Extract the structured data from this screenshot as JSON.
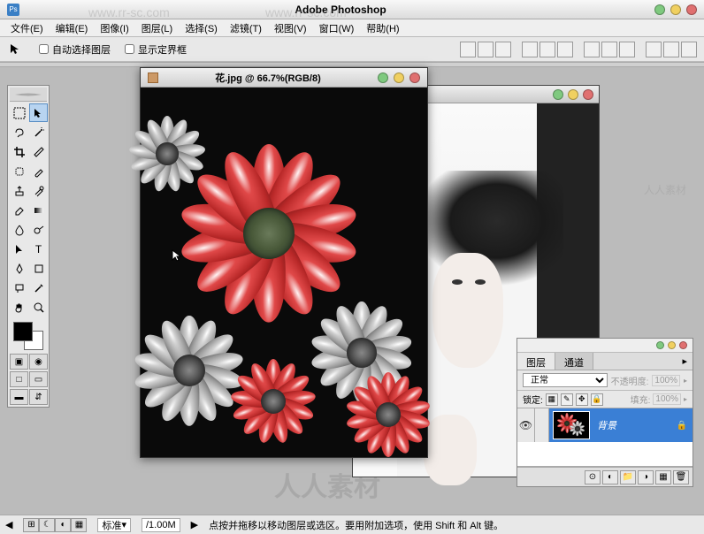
{
  "app": {
    "title": "Adobe Photoshop"
  },
  "menu": {
    "file": "文件(E)",
    "edit": "编辑(E)",
    "image": "图像(I)",
    "layer": "图层(L)",
    "select": "选择(S)",
    "filter": "滤镜(T)",
    "view": "视图(V)",
    "window": "窗口(W)",
    "help": "帮助(H)"
  },
  "options": {
    "auto_select": "自动选择图层",
    "show_bounds": "显示定界框"
  },
  "documents": {
    "flower": {
      "title": "花.jpg @ 66.7%(RGB/8)"
    }
  },
  "layers_panel": {
    "tab_layers": "图层",
    "tab_channels": "通道",
    "blend_mode": "正常",
    "opacity_label": "不透明度:",
    "opacity_value": "100%",
    "lock_label": "锁定:",
    "fill_label": "填充:",
    "fill_value": "100%",
    "layer_name": "背景"
  },
  "statusbar": {
    "zoom": "标准",
    "doc_size": "/1.00M",
    "hint": "点按并拖移以移动图层或选区。要用附加选项，使用 Shift 和 Alt 键。"
  },
  "watermark": {
    "url": "www.rr-sc.com",
    "brand": "人人素材"
  }
}
